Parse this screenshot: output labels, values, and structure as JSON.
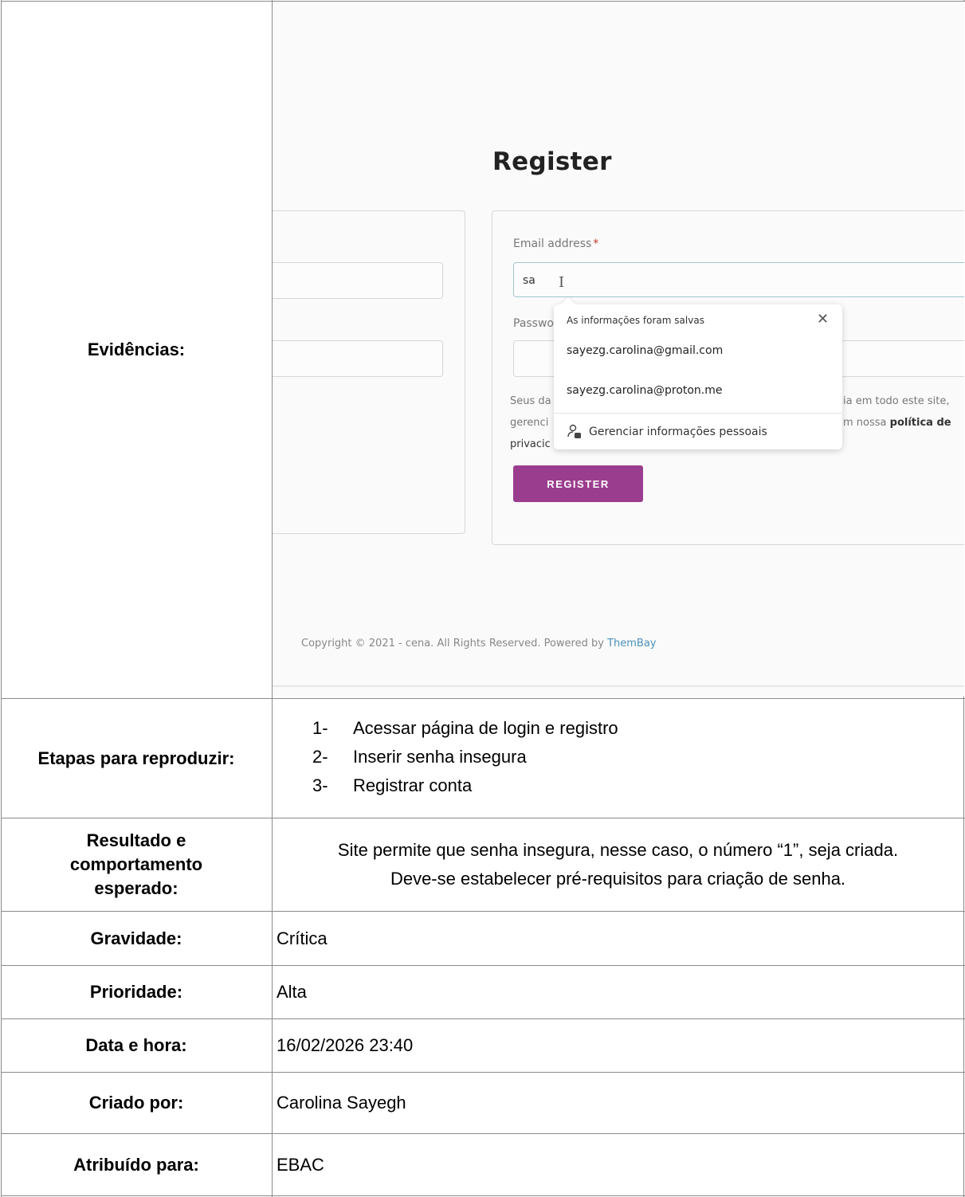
{
  "evidence": {
    "label": "Evidências:",
    "screenshot": {
      "title": "Register",
      "email_label": "Email address",
      "required_mark": "*",
      "email_value": "sa",
      "password_label_partial": "Passwo",
      "privacy_line1_left": "Seus da",
      "privacy_line1_right": "ia em todo este site, ",
      "privacy_line2_left": "gerenci",
      "privacy_line2_right_a": "m nossa ",
      "privacy_line2_right_b": "política de",
      "privacy_line3_left": "privacic",
      "register_button": "REGISTER",
      "copyright_text": "Copyright © 2021 - cena. All Rights Reserved. Powered by ",
      "copyright_link": "ThemBay",
      "autofill": {
        "title": "As informações foram salvas",
        "items": [
          "sayezg.carolina@gmail.com",
          "sayezg.carolina@proton.me"
        ],
        "manage": "Gerenciar informações pessoais"
      }
    }
  },
  "steps": {
    "label": "Etapas para reproduzir:",
    "items": [
      {
        "num": "1-",
        "text": "Acessar página de login e registro"
      },
      {
        "num": "2-",
        "text": "Inserir senha insegura"
      },
      {
        "num": "3-",
        "text": "Registrar conta"
      }
    ]
  },
  "result": {
    "label_line1": "Resultado e",
    "label_line2": "comportamento",
    "label_line3": "esperado:",
    "line1": "Site permite que senha insegura, nesse caso, o número “1”, seja criada.",
    "line2": "Deve-se estabelecer pré-requisitos para criação de senha."
  },
  "severity": {
    "label": "Gravidade:",
    "value": "Crítica"
  },
  "priority": {
    "label": "Prioridade:",
    "value": "Alta"
  },
  "datetime": {
    "label": "Data e hora:",
    "value": "16/02/2026 23:40"
  },
  "created_by": {
    "label": "Criado por:",
    "value": "Carolina Sayegh"
  },
  "assigned_to": {
    "label": "Atribuído para:",
    "value": "EBAC"
  }
}
